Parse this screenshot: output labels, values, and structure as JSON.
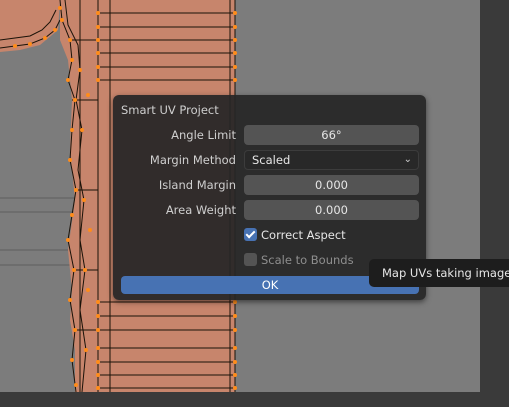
{
  "dialog": {
    "title": "Smart UV Project",
    "fields": {
      "angle_limit_label": "Angle Limit",
      "angle_limit_value": "66°",
      "margin_method_label": "Margin Method",
      "margin_method_value": "Scaled",
      "island_margin_label": "Island Margin",
      "island_margin_value": "0.000",
      "area_weight_label": "Area Weight",
      "area_weight_value": "0.000"
    },
    "checkboxes": {
      "correct_aspect_label": "Correct Aspect",
      "correct_aspect_checked": true,
      "scale_to_bounds_label": "Scale to Bounds",
      "scale_to_bounds_checked": false
    },
    "ok_label": "OK"
  },
  "tooltip": {
    "text": "Map UVs taking image as"
  },
  "colors": {
    "mesh_fill": "#c7856c",
    "mesh_edge": "#ff8c1a",
    "accent": "#4772b3",
    "background": "#7c7c7c"
  }
}
